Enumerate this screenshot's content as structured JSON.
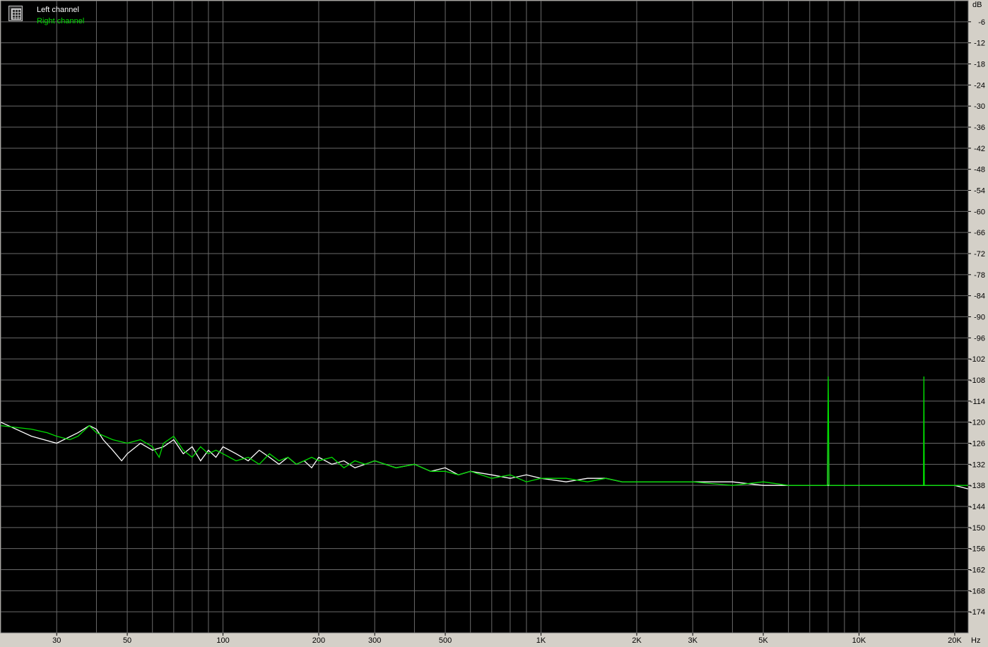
{
  "chart_data": {
    "type": "line",
    "xscale": "log",
    "xlim": [
      20,
      22050
    ],
    "ylim": [
      -180,
      0
    ],
    "yunit": "dB",
    "xunit": "Hz",
    "grid": true,
    "legend_placement": "top-left",
    "xticks": [
      {
        "v": 30,
        "label": "30"
      },
      {
        "v": 50,
        "label": "50"
      },
      {
        "v": 100,
        "label": "100"
      },
      {
        "v": 200,
        "label": "200"
      },
      {
        "v": 300,
        "label": "300"
      },
      {
        "v": 500,
        "label": "500"
      },
      {
        "v": 1000,
        "label": "1K"
      },
      {
        "v": 2000,
        "label": "2K"
      },
      {
        "v": 3000,
        "label": "3K"
      },
      {
        "v": 5000,
        "label": "5K"
      },
      {
        "v": 10000,
        "label": "10K"
      },
      {
        "v": 20000,
        "label": "20K"
      }
    ],
    "xgrid_minor": [
      30,
      40,
      50,
      60,
      70,
      80,
      90,
      100,
      200,
      300,
      400,
      500,
      600,
      700,
      800,
      900,
      1000,
      2000,
      3000,
      4000,
      5000,
      6000,
      7000,
      8000,
      9000,
      10000,
      20000
    ],
    "yticks": [
      -6,
      -12,
      -18,
      -24,
      -30,
      -36,
      -42,
      -48,
      -54,
      -60,
      -66,
      -72,
      -78,
      -84,
      -90,
      -96,
      -102,
      -108,
      -114,
      -120,
      -126,
      -132,
      -138,
      -144,
      -150,
      -156,
      -162,
      -168,
      -174
    ],
    "series": [
      {
        "name": "Left channel",
        "color": "#ffffff",
        "x": [
          20,
          25,
          30,
          35,
          38,
          40,
          42,
          45,
          48,
          50,
          55,
          60,
          65,
          70,
          75,
          80,
          85,
          90,
          95,
          100,
          110,
          120,
          130,
          140,
          150,
          160,
          170,
          180,
          190,
          200,
          220,
          240,
          260,
          280,
          300,
          350,
          400,
          450,
          500,
          550,
          600,
          700,
          800,
          900,
          1000,
          1200,
          1400,
          1600,
          1800,
          2000,
          2500,
          3000,
          4000,
          5000,
          6000,
          7000,
          8000,
          10000,
          12000,
          14000,
          16000,
          18000,
          20000,
          22000
        ],
        "y": [
          -120,
          -124,
          -126,
          -123,
          -121,
          -122,
          -125,
          -128,
          -131,
          -129,
          -126,
          -128,
          -127,
          -125,
          -129,
          -127,
          -131,
          -128,
          -130,
          -127,
          -129,
          -131,
          -128,
          -130,
          -132,
          -130,
          -132,
          -131,
          -133,
          -130,
          -132,
          -131,
          -133,
          -132,
          -131,
          -133,
          -132,
          -134,
          -133,
          -135,
          -134,
          -135,
          -136,
          -135,
          -136,
          -137,
          -136,
          -136,
          -137,
          -137,
          -137,
          -137,
          -137,
          -138,
          -138,
          -138,
          -138,
          -138,
          -138,
          -138,
          -138,
          -138,
          -138,
          -139
        ]
      },
      {
        "name": "Right channel",
        "color": "#00dd00",
        "x": [
          20,
          25,
          28,
          30,
          33,
          35,
          38,
          40,
          45,
          50,
          55,
          60,
          63,
          65,
          70,
          75,
          80,
          85,
          90,
          95,
          100,
          110,
          120,
          130,
          140,
          150,
          160,
          170,
          180,
          190,
          200,
          220,
          240,
          260,
          280,
          300,
          350,
          400,
          450,
          500,
          550,
          600,
          700,
          800,
          900,
          1000,
          1200,
          1400,
          1600,
          1800,
          2000,
          2500,
          3000,
          4000,
          5000,
          6000,
          7000,
          7950,
          8000,
          8050,
          9000,
          10000,
          12000,
          14000,
          15950,
          16000,
          16050,
          18000,
          20000,
          22000
        ],
        "y": [
          -121,
          -122,
          -123,
          -124,
          -125,
          -124,
          -121,
          -123,
          -125,
          -126,
          -125,
          -127,
          -130,
          -126,
          -124,
          -128,
          -130,
          -127,
          -129,
          -128,
          -129,
          -131,
          -130,
          -132,
          -129,
          -131,
          -130,
          -132,
          -131,
          -130,
          -131,
          -130,
          -133,
          -131,
          -132,
          -131,
          -133,
          -132,
          -134,
          -134,
          -135,
          -134,
          -136,
          -135,
          -137,
          -136,
          -136,
          -137,
          -136,
          -137,
          -137,
          -137,
          -137,
          -138,
          -137,
          -138,
          -138,
          -138,
          -107,
          -138,
          -138,
          -138,
          -138,
          -138,
          -138,
          -107,
          -138,
          -138,
          -138,
          -138
        ]
      }
    ]
  },
  "legend": {
    "items": [
      {
        "label": "Left channel",
        "color": "#ffffff"
      },
      {
        "label": "Right channel",
        "color": "#00dd00"
      }
    ]
  },
  "axis": {
    "y_unit_label": "dB",
    "x_unit_label": "Hz"
  }
}
